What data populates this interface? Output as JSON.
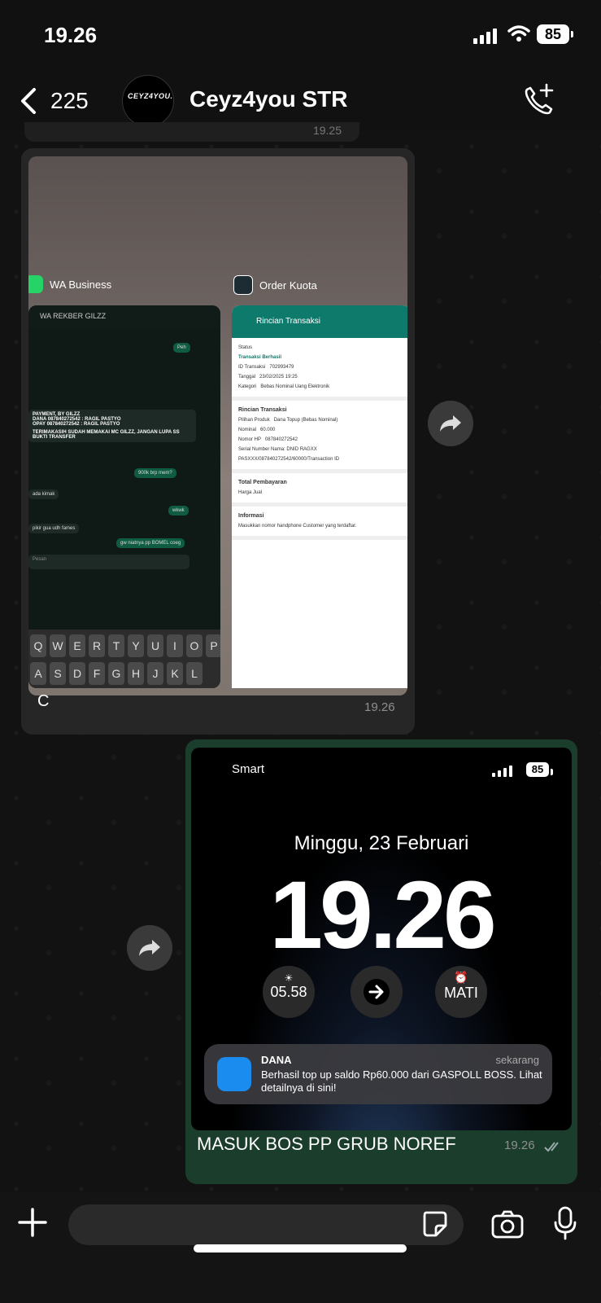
{
  "status_bar": {
    "time": "19.26",
    "battery": "85"
  },
  "header": {
    "back_count": "225",
    "contact_name": "Ceyz4you STR",
    "avatar_logo": "CEYZ4YOU.STR"
  },
  "peek_message": {
    "time": "19.25"
  },
  "incoming_message": {
    "caption": "C",
    "time": "19.26",
    "screenshot": {
      "left_app": "WA Business",
      "right_app": "Order Kuota",
      "wa_chat_title": "WA REKBER GILZZ",
      "wa_lines": [
        "PAYMENT, BY GILZZ",
        "DANA 087840272542 : RAGIL PASTYO",
        "OPAY 087840272542 : RAGIL PASTYO",
        "TERIMAKASIH SUDAH MEMAKAI MC GILZZ, JANGAN LUPA SS BUKTI TRANSFER",
        "900k brp mem?",
        "ada kimak",
        "wkwk",
        "pikir gua udh fames",
        "gw niatnya pp BOMEL coeg"
      ],
      "wa_input_placeholder": "Pesan",
      "keyboard_row1": [
        "Q",
        "W",
        "E",
        "R",
        "T",
        "Y",
        "U",
        "I",
        "O",
        "P"
      ],
      "keyboard_row2": [
        "A",
        "S",
        "D",
        "F",
        "G",
        "H",
        "J",
        "K",
        "L"
      ],
      "ok_title": "Rincian Transaksi",
      "ok_status_label": "Status",
      "ok_status": "Transaksi Berhasil",
      "ok_id_label": "ID Transaksi",
      "ok_id": "702993479",
      "ok_date_label": "Tanggal",
      "ok_date": "23/02/2025 19:25",
      "ok_cat_label": "Kategori",
      "ok_cat": "Bebas Nominal Uang Elektronik",
      "ok_detail_title": "Rincian Transaksi",
      "ok_product_label": "Pilihan Produk",
      "ok_product": "Dana Topup (Bebas Nominal)",
      "ok_nominal_label": "Nominal",
      "ok_nominal": "60.000",
      "ok_hp_label": "Nomor HP",
      "ok_hp": "087840272542",
      "ok_serial_label": "Serial Number",
      "ok_serial": "Nama: DNID RAGXX PASXXX/087840272542/60000/Transaction ID",
      "ok_total_title": "Total Pembayaran",
      "ok_price_label": "Harga Jual",
      "ok_info_title": "Informasi",
      "ok_info": "Masukkan nomor handphone Customer yang terdaftar."
    }
  },
  "outgoing_message": {
    "caption": "MASUK BOS PP GRUB NOREF",
    "time": "19.26",
    "lockscreen": {
      "carrier": "Smart",
      "battery": "85",
      "date": "Minggu, 23 Februari",
      "time": "19.26",
      "widget_left": "05.58",
      "widget_right": "MATI",
      "notif_app": "DANA",
      "notif_when": "sekarang",
      "notif_body": "Berhasil top up saldo Rp60.000 dari GASPOLL BOSS. Lihat detailnya di sini!"
    }
  },
  "colors": {
    "accent_green": "#1b3d2c",
    "header_bg": "#111111"
  }
}
